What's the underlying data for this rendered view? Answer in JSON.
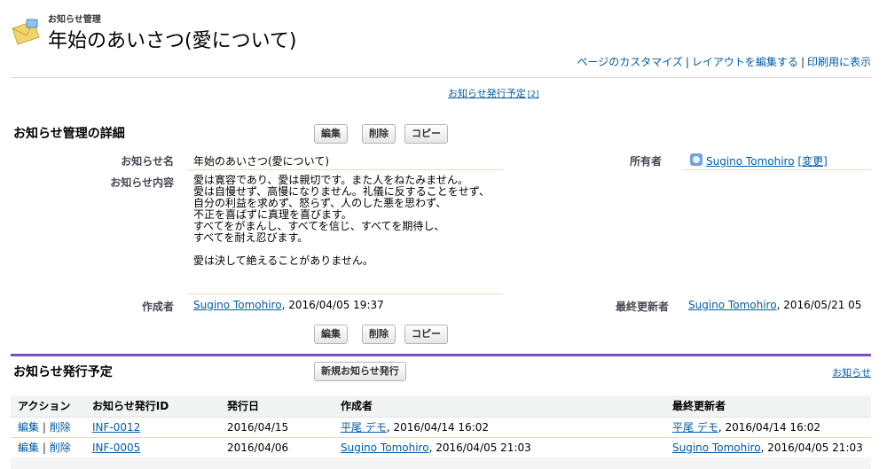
{
  "header": {
    "breadcrumb": "お知らせ管理",
    "title": "年始のあいさつ(愛について)",
    "links": [
      "ページのカスタマイズ",
      "レイアウトを編集する",
      "印刷用に表示"
    ],
    "link_separator": "|",
    "related_link": "お知らせ発行予定",
    "related_link_count": "[2]"
  },
  "detail": {
    "section_title": "お知らせ管理の詳細",
    "buttons": {
      "edit": "編集",
      "delete": "削除",
      "copy": "コピー"
    },
    "fields": {
      "name_label": "お知らせ名",
      "name_value": "年始のあいさつ(愛について)",
      "owner_label": "所有者",
      "owner_value": "Sugino Tomohiro",
      "owner_change": "[変更]",
      "content_label": "お知らせ内容",
      "content_value": "愛は寛容であり、愛は親切です。また人をねたみません。\n愛は自慢せず、高慢になりません。礼儀に反することをせず、\n自分の利益を求めず、怒らず、人のした悪を思わず、\n不正を喜ばずに真理を喜びます。\nすべてをがまんし、すべてを信じ、すべてを期待し、\nすべてを耐え忍びます。\n\n愛は決して絶えることがありません。",
      "created_by_label": "作成者",
      "created_by_user": "Sugino Tomohiro",
      "created_by_date": ", 2016/04/05 19:37",
      "modified_by_label": "最終更新者",
      "modified_by_user": "Sugino Tomohiro",
      "modified_by_date": ", 2016/05/21 05"
    }
  },
  "related_list": {
    "title": "お知らせ発行予定",
    "new_button": "新規お知らせ発行",
    "right_link": "お知らせ",
    "columns": [
      "アクション",
      "お知らせ発行ID",
      "発行日",
      "作成者",
      "最終更新者"
    ],
    "action_edit": "編集",
    "action_delete": "削除",
    "rows": [
      {
        "id": "INF-0012",
        "date": "2016/04/15",
        "creator": "平尾 デモ",
        "created": ", 2016/04/14 16:02",
        "modifier": "平尾 デモ",
        "modified": ", 2016/04/14 16:02"
      },
      {
        "id": "INF-0005",
        "date": "2016/04/06",
        "creator": "Sugino Tomohiro",
        "created": ", 2016/04/05 21:03",
        "modifier": "Sugino Tomohiro",
        "modified": ", 2016/04/05 21:03"
      }
    ]
  },
  "colors": {
    "link": "#015ba7",
    "list_accent": "#7a4ec4",
    "row_rule": "#e3deb8"
  }
}
